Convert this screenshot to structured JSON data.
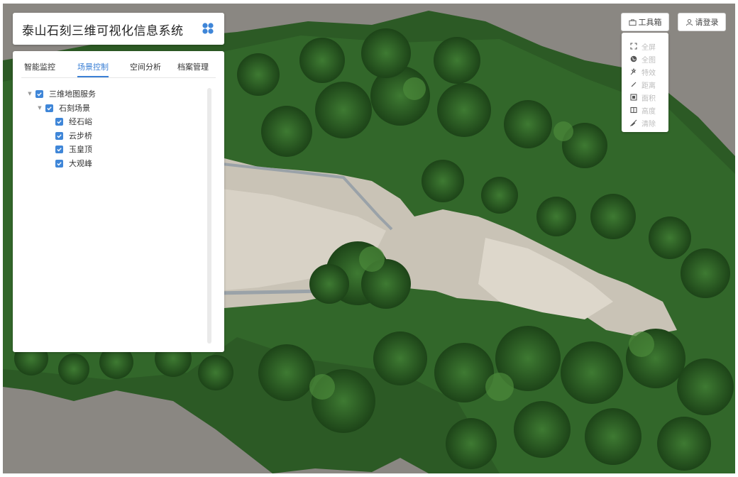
{
  "app": {
    "title": "泰山石刻三维可视化信息系统"
  },
  "tabs": [
    {
      "label": "智能监控",
      "active": false
    },
    {
      "label": "场景控制",
      "active": true
    },
    {
      "label": "空间分析",
      "active": false
    },
    {
      "label": "档案管理",
      "active": false
    }
  ],
  "tree": {
    "root": {
      "label": "三维地图服务",
      "checked": true
    },
    "group": {
      "label": "石刻场景",
      "checked": true
    },
    "items": [
      {
        "label": "经石峪",
        "checked": true
      },
      {
        "label": "云步桥",
        "checked": true
      },
      {
        "label": "玉皇顶",
        "checked": true
      },
      {
        "label": "大观峰",
        "checked": true
      }
    ]
  },
  "toolbar": {
    "toolbox_label": "工具箱",
    "login_label": "请登录"
  },
  "tools": [
    {
      "label": "全屏",
      "icon": "fullscreen-icon"
    },
    {
      "label": "全图",
      "icon": "globe-icon"
    },
    {
      "label": "特效",
      "icon": "effects-icon"
    },
    {
      "label": "距离",
      "icon": "ruler-icon"
    },
    {
      "label": "面积",
      "icon": "area-icon"
    },
    {
      "label": "高度",
      "icon": "height-icon"
    },
    {
      "label": "清除",
      "icon": "clear-icon"
    }
  ],
  "colors": {
    "accent": "#3a7fd5",
    "checkbox": "#3f86d8",
    "tool_text": "#bdbdbd"
  }
}
